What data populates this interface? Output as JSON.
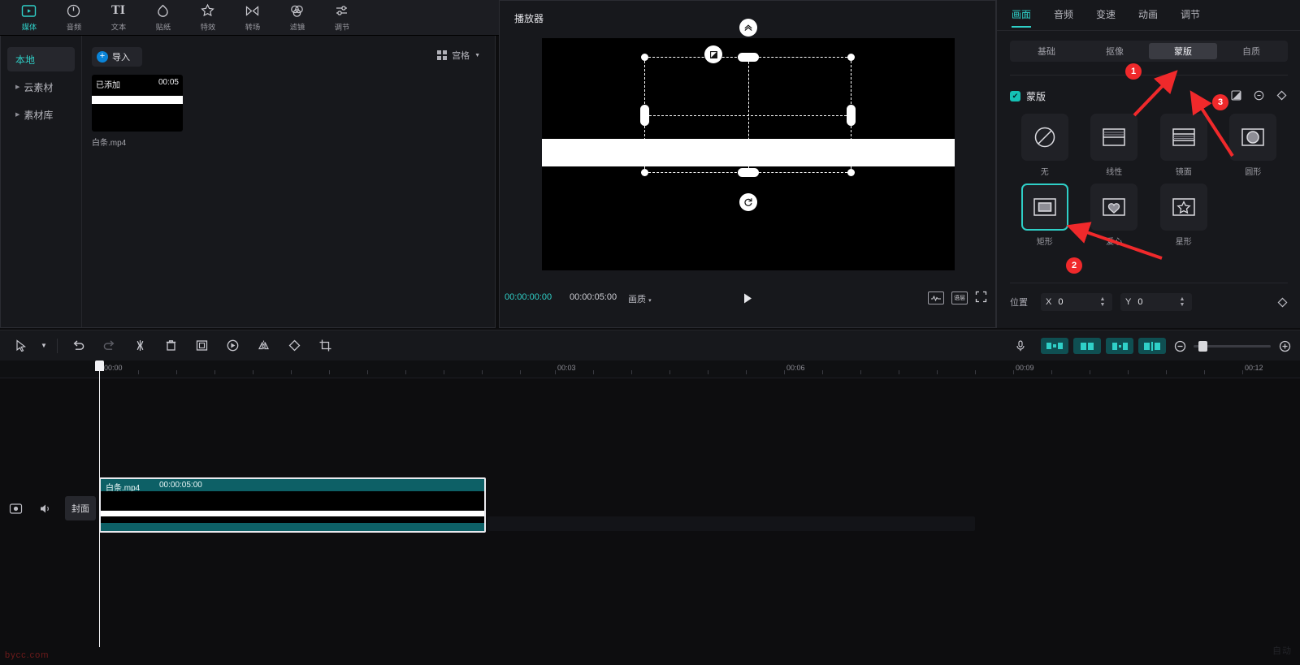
{
  "app": {
    "player_title": "播放器"
  },
  "top_toolbar": {
    "tabs": [
      {
        "label": "媒体",
        "icon": "media-icon",
        "active": true
      },
      {
        "label": "音频",
        "icon": "audio-icon",
        "active": false
      },
      {
        "label": "文本",
        "icon": "text-icon",
        "active": false
      },
      {
        "label": "贴纸",
        "icon": "sticker-icon",
        "active": false
      },
      {
        "label": "特效",
        "icon": "effects-icon",
        "active": false
      },
      {
        "label": "转场",
        "icon": "transition-icon",
        "active": false
      },
      {
        "label": "滤镜",
        "icon": "filter-icon",
        "active": false
      },
      {
        "label": "调节",
        "icon": "adjust-icon",
        "active": false
      }
    ]
  },
  "media_panel": {
    "sidebar": [
      {
        "label": "本地",
        "active": true,
        "expandable": false
      },
      {
        "label": "云素材",
        "active": false,
        "expandable": true
      },
      {
        "label": "素材库",
        "active": false,
        "expandable": true
      }
    ],
    "import_label": "导入",
    "view_label": "宫格",
    "card": {
      "status": "已添加",
      "duration": "00:05",
      "filename": "白条.mp4"
    }
  },
  "player": {
    "current_time": "00:00:00:00",
    "total_time": "00:00:05:00",
    "quality_label": "画质",
    "mask_controls": {
      "invert_icon": "invert-mask-icon",
      "feather_icon": "feather-icon",
      "rotate_icon": "rotate-icon"
    },
    "right_icons": [
      "waveform-icon",
      "resolution-icon",
      "fullscreen-icon"
    ]
  },
  "properties": {
    "tabs": [
      {
        "label": "画面",
        "active": true
      },
      {
        "label": "音频",
        "active": false
      },
      {
        "label": "变速",
        "active": false
      },
      {
        "label": "动画",
        "active": false
      },
      {
        "label": "调节",
        "active": false
      }
    ],
    "sub_tabs": [
      {
        "label": "基础",
        "active": false
      },
      {
        "label": "抠像",
        "active": false
      },
      {
        "label": "蒙版",
        "active": true
      },
      {
        "label": "自质",
        "active": false
      }
    ],
    "mask_section": {
      "title": "蒙版",
      "enabled": true,
      "tools": [
        "invert-mask-icon",
        "reset-mask-icon",
        "keyframe-icon"
      ]
    },
    "shapes": [
      {
        "label": "无",
        "icon": "none-icon",
        "selected": false
      },
      {
        "label": "线性",
        "icon": "linear-mask-icon",
        "selected": false
      },
      {
        "label": "镜面",
        "icon": "mirror-mask-icon",
        "selected": false
      },
      {
        "label": "圆形",
        "icon": "circle-mask-icon",
        "selected": false
      },
      {
        "label": "矩形",
        "icon": "rectangle-mask-icon",
        "selected": true
      },
      {
        "label": "爱心",
        "icon": "heart-mask-icon",
        "selected": false
      },
      {
        "label": "星形",
        "icon": "star-mask-icon",
        "selected": false
      }
    ],
    "position": {
      "label": "位置",
      "x_axis": "X",
      "x_value": "0",
      "y_axis": "Y",
      "y_value": "0"
    }
  },
  "timeline": {
    "toolbar_left": [
      {
        "icon": "cursor-tool-icon"
      },
      {
        "icon": "chevron-down-icon"
      },
      {
        "icon": "undo-icon"
      },
      {
        "icon": "redo-icon"
      },
      {
        "icon": "split-icon"
      },
      {
        "icon": "delete-icon"
      },
      {
        "icon": "crop-frame-icon"
      },
      {
        "icon": "speed-icon"
      },
      {
        "icon": "mirror-icon"
      },
      {
        "icon": "rotate-clip-icon"
      },
      {
        "icon": "crop-icon"
      }
    ],
    "toolbar_right": [
      {
        "icon": "microphone-icon"
      },
      {
        "icon": "track-auto-icon"
      },
      {
        "icon": "track-magnet-icon"
      },
      {
        "icon": "track-link-icon"
      },
      {
        "icon": "track-preview-icon"
      },
      {
        "icon": "zoom-out-icon"
      },
      {
        "icon": "zoom-in-icon"
      }
    ],
    "ruler_marks": [
      "00:00",
      "00:03",
      "00:06",
      "00:09",
      "00:12",
      "00:"
    ],
    "track_header": {
      "add_icon": "add-track-icon",
      "mute_icon": "mute-icon",
      "cover_label": "封面"
    },
    "clip": {
      "name": "白条.mp4",
      "duration": "00:00:05:00"
    }
  },
  "annotations": [
    {
      "number": "1",
      "target": "mask-subtab"
    },
    {
      "number": "2",
      "target": "rectangle-shape"
    },
    {
      "number": "3",
      "target": "mask-tools"
    }
  ],
  "watermark": {
    "text": "bycc.com",
    "bottom_right": "自动"
  },
  "colors": {
    "accent_teal": "#2fd0c8",
    "clip_teal": "#0d6066",
    "anno_red": "#f0292b",
    "panel_bg": "#17181c"
  }
}
